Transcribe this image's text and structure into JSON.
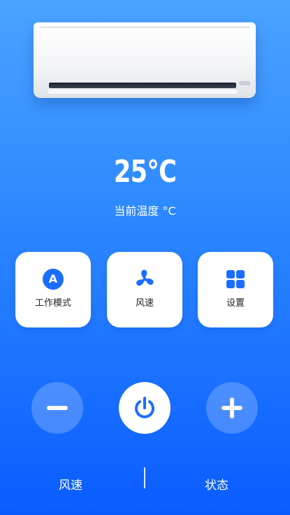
{
  "temperature": {
    "value": "25°C",
    "label": "当前温度 °C"
  },
  "cards": {
    "mode": {
      "icon_letter": "A",
      "label": "工作模式"
    },
    "fan": {
      "label": "风速"
    },
    "setting": {
      "label": "设置"
    }
  },
  "bottom": {
    "left_label": "风速",
    "right_label": "状态"
  },
  "icons": {
    "mode": "mode-a-icon",
    "fan": "fan-icon",
    "setting": "grid-icon",
    "minus": "minus-icon",
    "power": "power-icon",
    "plus": "plus-icon"
  },
  "colors": {
    "accent": "#1b6dff",
    "background_top": "#4aa3ff",
    "background_bottom": "#0a5cff"
  }
}
